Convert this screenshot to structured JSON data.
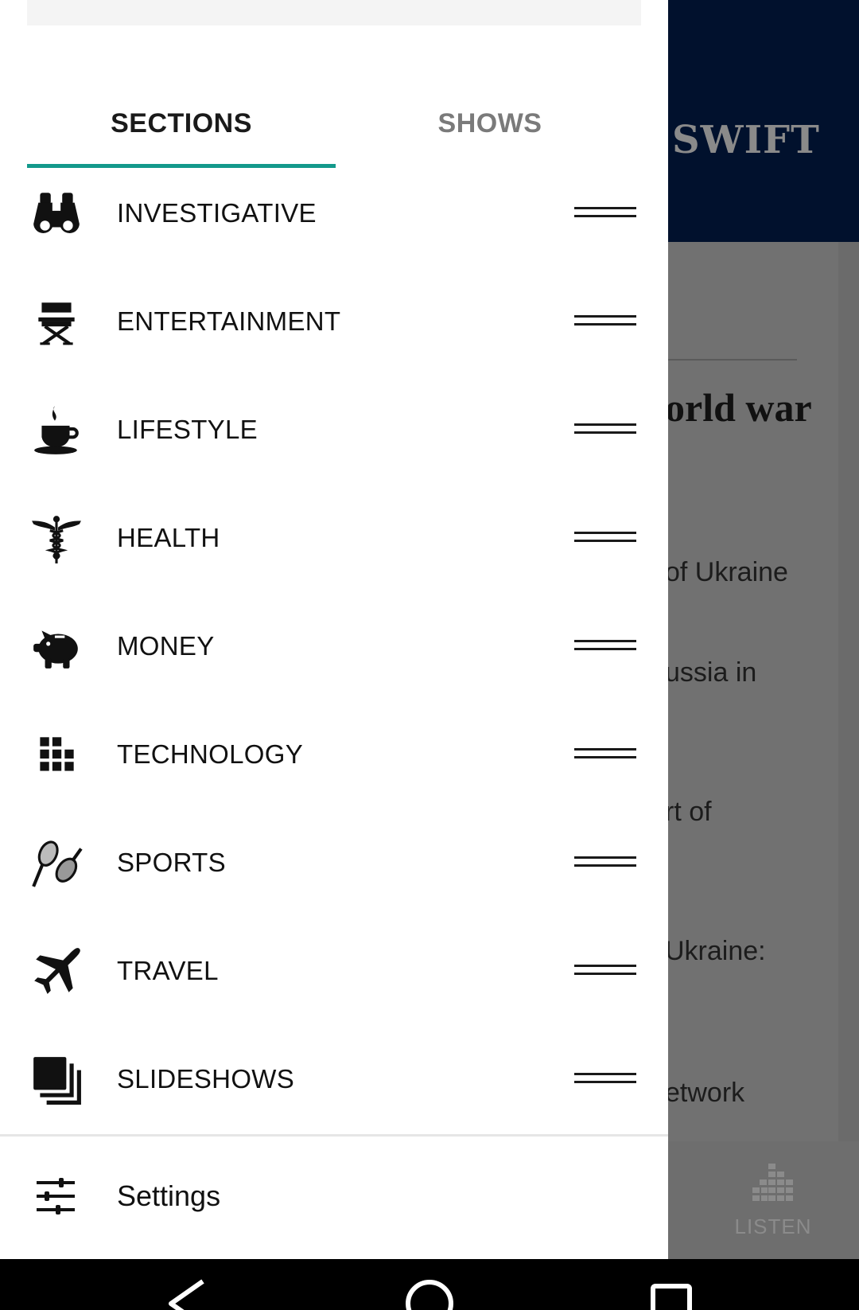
{
  "background": {
    "logo_text": "SWIFT",
    "headline_fragment": "orld war",
    "lines": [
      "of Ukraine",
      "ussia in",
      "rt of",
      "Ukraine:",
      "etwork"
    ],
    "bottom_nav": {
      "listen_label": "LISTEN",
      "listen_icon": "equalizer-grid-icon"
    }
  },
  "drawer": {
    "tabs": [
      {
        "label": "SECTIONS",
        "active": true
      },
      {
        "label": "SHOWS",
        "active": false
      }
    ],
    "accent_color": "#13998b",
    "sections": [
      {
        "label": "INVESTIGATIVE",
        "icon": "binoculars-icon"
      },
      {
        "label": "ENTERTAINMENT",
        "icon": "directors-chair-icon"
      },
      {
        "label": "LIFESTYLE",
        "icon": "coffee-cup-icon"
      },
      {
        "label": "HEALTH",
        "icon": "caduceus-icon"
      },
      {
        "label": "MONEY",
        "icon": "piggy-bank-icon"
      },
      {
        "label": "TECHNOLOGY",
        "icon": "grid-icon"
      },
      {
        "label": "SPORTS",
        "icon": "tennis-rackets-icon"
      },
      {
        "label": "TRAVEL",
        "icon": "airplane-icon"
      },
      {
        "label": "SLIDESHOWS",
        "icon": "stacked-squares-icon"
      }
    ],
    "settings": {
      "label": "Settings",
      "icon": "sliders-icon"
    }
  },
  "system_nav": {
    "buttons": [
      {
        "name": "back",
        "icon": "back-triangle-icon"
      },
      {
        "name": "home",
        "icon": "home-circle-icon"
      },
      {
        "name": "recents",
        "icon": "recents-square-icon"
      }
    ]
  }
}
